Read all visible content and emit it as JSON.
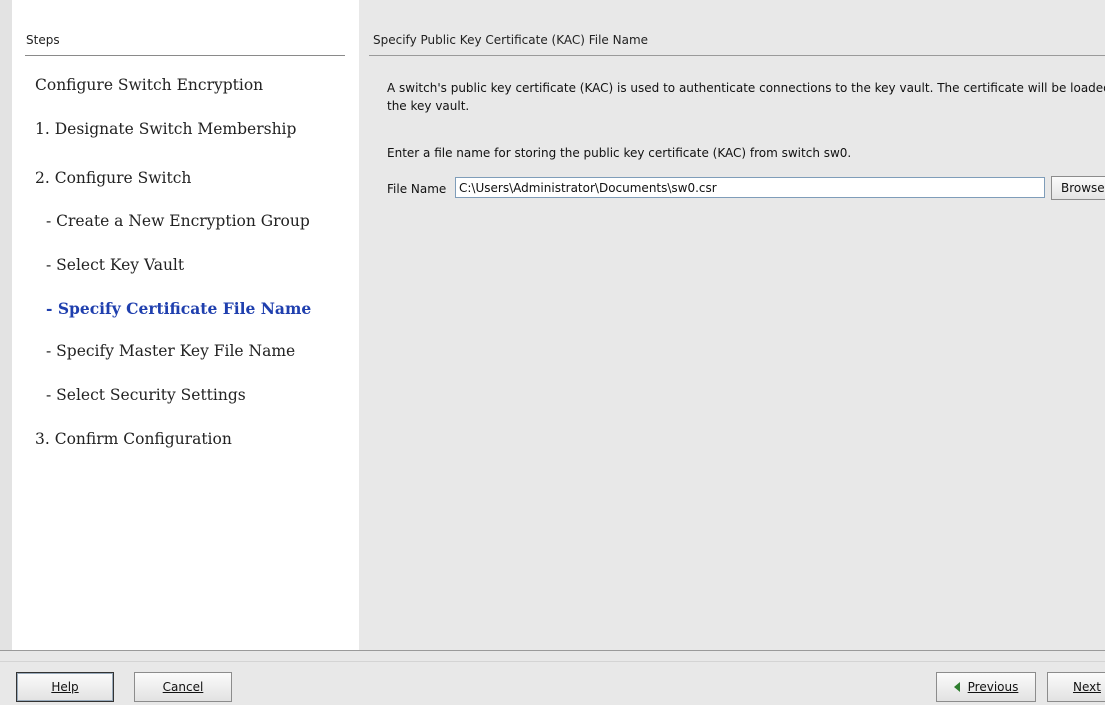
{
  "sidebar": {
    "header": "Steps",
    "steps": [
      {
        "label": "Configure Switch Encryption"
      },
      {
        "label": "1. Designate Switch Membership"
      },
      {
        "label": "2. Configure Switch"
      },
      {
        "label": "- Create a New Encryption Group"
      },
      {
        "label": "- Select Key Vault"
      },
      {
        "label": "- Specify Certificate File Name",
        "active": true
      },
      {
        "label": "- Specify Master Key File Name"
      },
      {
        "label": "- Select Security Settings"
      },
      {
        "label": "3. Confirm Configuration"
      }
    ]
  },
  "main": {
    "title": "Specify Public Key Certificate (KAC) File Name",
    "description": "A switch's public key certificate (KAC) is used to authenticate connections to the key vault. The certificate will be loaded into the key vault.",
    "prompt": "Enter a file name for storing the public key certificate (KAC) from switch sw0.",
    "file_label": "File Name",
    "file_value": "C:\\Users\\Administrator\\Documents\\sw0.csr",
    "browse_label": "Browse..."
  },
  "footer": {
    "help_label": "Help",
    "cancel_label": "Cancel",
    "previous_label": "Previous",
    "next_label": "Next"
  },
  "colors": {
    "active_step": "#1f3fae",
    "previous_arrow": "#2e7d2e"
  },
  "icons": {
    "previous": "previous-arrow-icon"
  }
}
